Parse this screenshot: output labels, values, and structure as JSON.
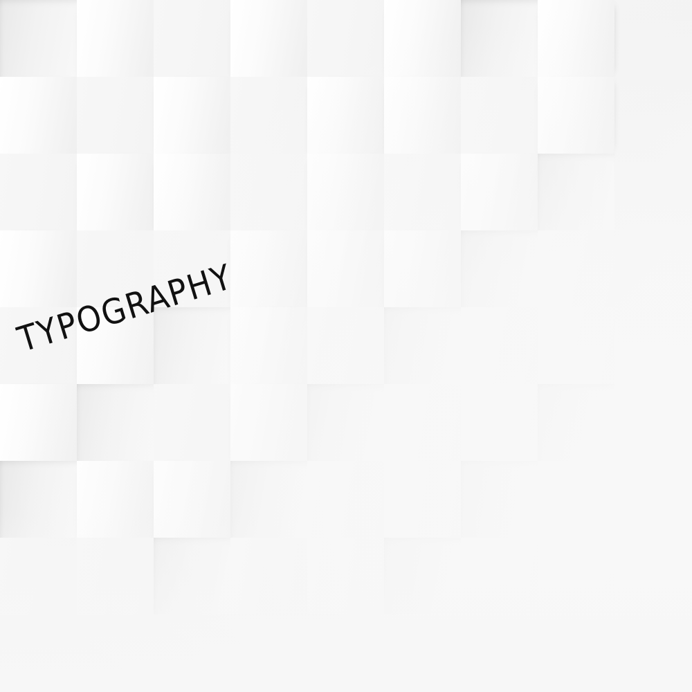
{
  "headline": {
    "text": "TYPOGRAPHY",
    "color": "#111111"
  },
  "background": {
    "style": "white 3D paper tile pattern",
    "base_color": "#f4f4f4"
  }
}
